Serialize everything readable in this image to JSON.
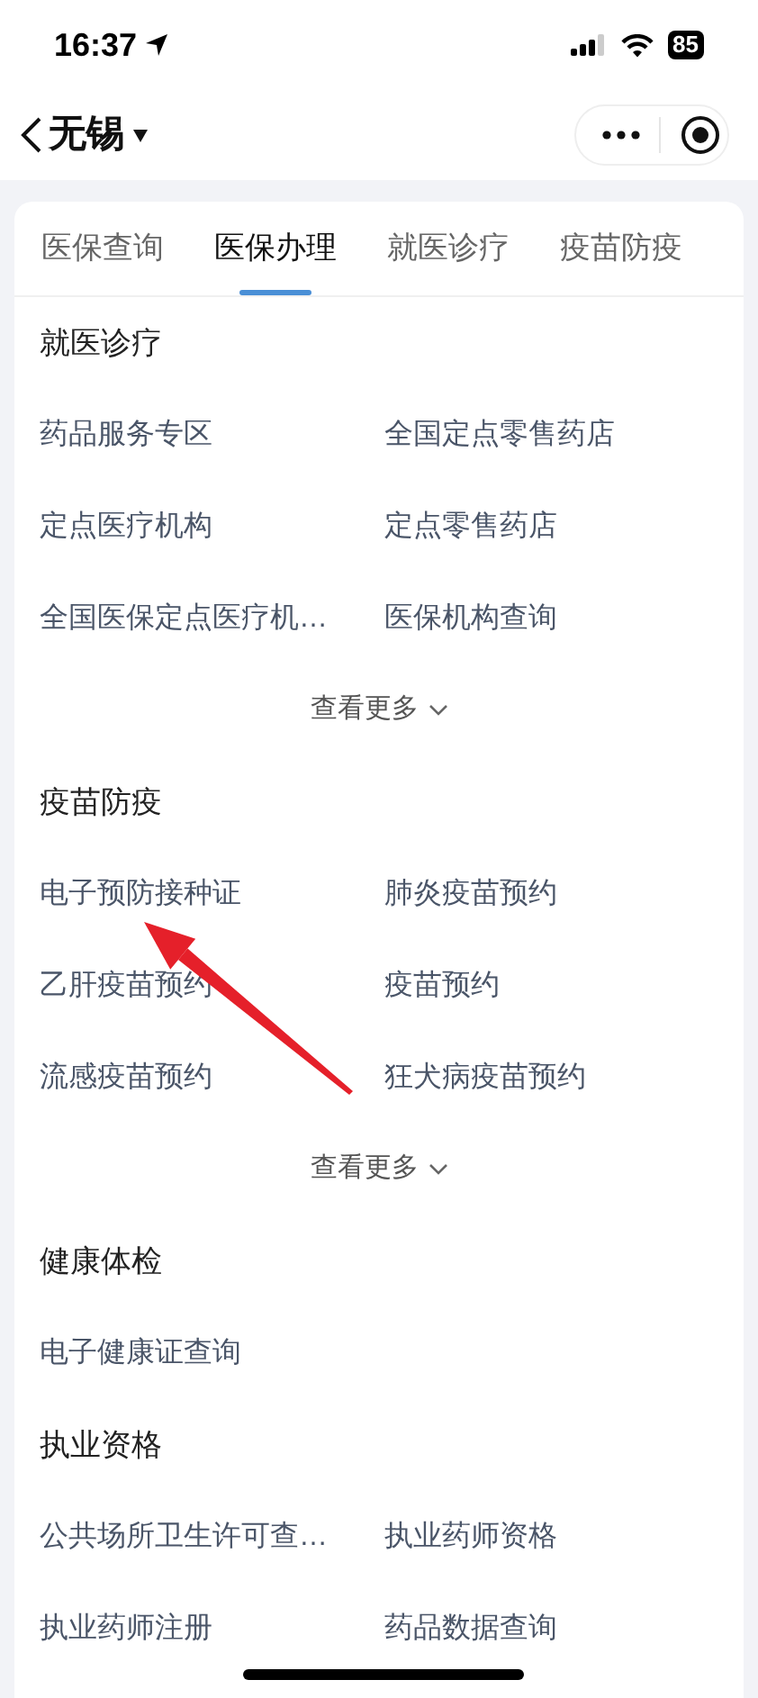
{
  "status_bar": {
    "time": "16:37",
    "battery": "85"
  },
  "nav": {
    "title": "无锡"
  },
  "tabs": [
    {
      "label": "医保查询",
      "selected": false
    },
    {
      "label": "医保办理",
      "selected": true
    },
    {
      "label": "就医诊疗",
      "selected": false
    },
    {
      "label": "疫苗防疫",
      "selected": false
    }
  ],
  "sections": [
    {
      "title": "就医诊疗",
      "items": [
        "药品服务专区",
        "全国定点零售药店",
        "定点医疗机构",
        "定点零售药店",
        "全国医保定点医疗机…",
        "医保机构查询"
      ],
      "more": "查看更多"
    },
    {
      "title": "疫苗防疫",
      "items": [
        "电子预防接种证",
        "肺炎疫苗预约",
        "乙肝疫苗预约",
        "疫苗预约",
        "流感疫苗预约",
        "狂犬病疫苗预约"
      ],
      "more": "查看更多"
    },
    {
      "title": "健康体检",
      "items": [
        "电子健康证查询"
      ]
    },
    {
      "title": "执业资格",
      "items": [
        "公共场所卫生许可查…",
        "执业药师资格",
        "执业药师注册",
        "药品数据查询"
      ]
    }
  ]
}
